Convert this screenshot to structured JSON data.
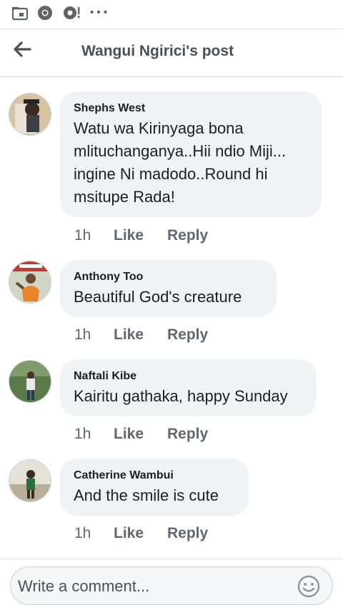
{
  "status_bar": {
    "icons": [
      "folder-calendar-icon",
      "chrome-icon",
      "settings-notification-icon",
      "more-dots-icon"
    ],
    "overflow_label": "• • •"
  },
  "header": {
    "back_icon": "arrow-left-icon",
    "title": "Wangui Ngirici's post"
  },
  "comments": [
    {
      "author": "Shephs West",
      "text": "Watu wa Kirinyaga bona mlituchanganya..Hii ndio Miji... ingine Ni madodo..Round hi msitupe Rada!",
      "time": "1h",
      "like_label": "Like",
      "reply_label": "Reply"
    },
    {
      "author": "Anthony Too",
      "text": "Beautiful God's creature",
      "time": "1h",
      "like_label": "Like",
      "reply_label": "Reply"
    },
    {
      "author": "Naftali Kibe",
      "text": "Kairitu gathaka, happy Sunday",
      "time": "1h",
      "like_label": "Like",
      "reply_label": "Reply"
    },
    {
      "author": "Catherine Wambui",
      "text": "And the smile is cute",
      "time": "1h",
      "like_label": "Like",
      "reply_label": "Reply"
    }
  ],
  "composer": {
    "placeholder": "Write a comment...",
    "emoji_icon": "smiley-icon"
  },
  "colors": {
    "bubble": "#f0f2f5",
    "secondary_text": "#606770",
    "divider": "#dddfe2"
  }
}
